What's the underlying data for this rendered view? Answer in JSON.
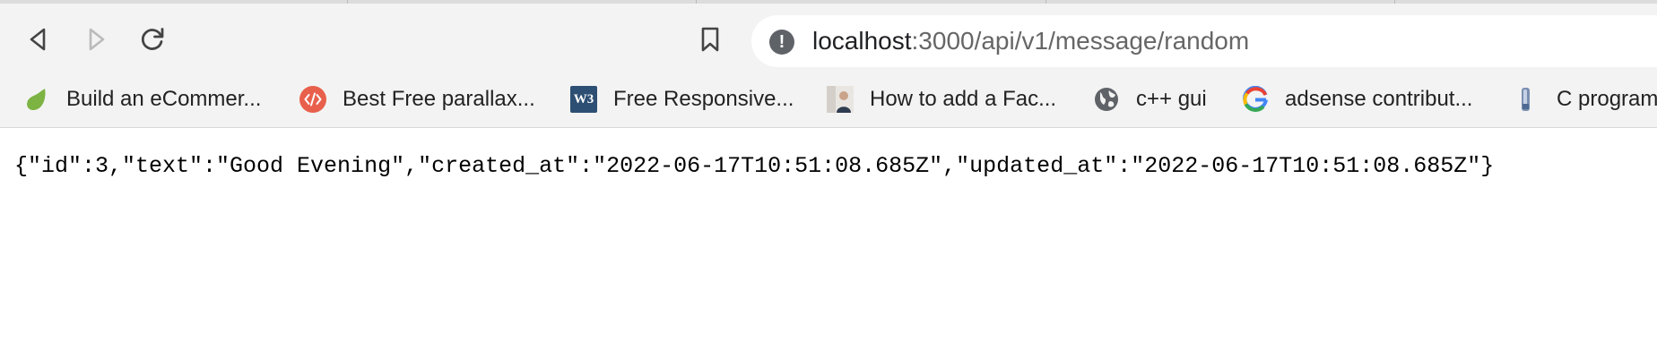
{
  "toolbar": {
    "back_icon": "back-arrow-icon",
    "forward_icon": "forward-arrow-icon",
    "reload_icon": "reload-icon",
    "bookmark_icon": "bookmark-icon",
    "info_icon": "info-icon",
    "info_symbol": "!"
  },
  "address_bar": {
    "host": "localhost",
    "rest": ":3000/api/v1/message/random"
  },
  "bookmarks": [
    {
      "label": "Build an eCommer...",
      "icon": "envato-leaf-icon"
    },
    {
      "label": "Best Free parallax...",
      "icon": "code-tag-icon"
    },
    {
      "label": "Free Responsive...",
      "icon": "w3-logo-icon",
      "icon_text": "W3"
    },
    {
      "label": "How to add a Fac...",
      "icon": "person-thumbnail-icon"
    },
    {
      "label": "c++ gui",
      "icon": "globe-icon"
    },
    {
      "label": "adsense contribut...",
      "icon": "google-g-icon"
    },
    {
      "label": "C program",
      "icon": "bottle-thumbnail-icon"
    }
  ],
  "page": {
    "json_text": "{\"id\":3,\"text\":\"Good Evening\",\"created_at\":\"2022-06-17T10:51:08.685Z\",\"updated_at\":\"2022-06-17T10:51:08.685Z\"}"
  },
  "colors": {
    "toolbar_bg": "#f3f3f3",
    "omnibox_bg": "#ffffff",
    "icon_gray": "#5f6368",
    "leaf_green": "#7cb342",
    "code_red": "#e8604c",
    "w3_blue": "#2d4f73"
  }
}
